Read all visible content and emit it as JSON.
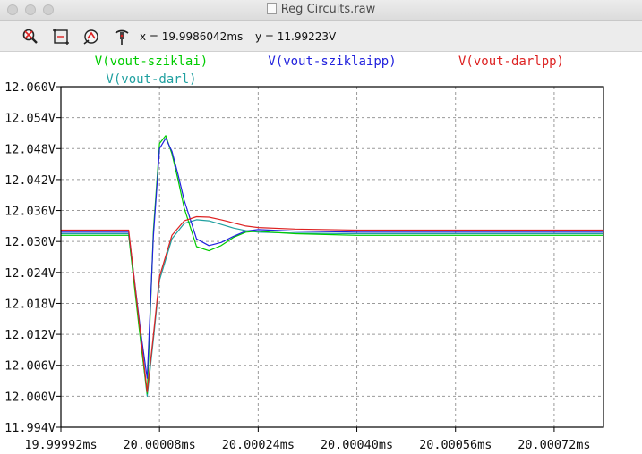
{
  "window": {
    "title": "Reg Circuits.raw"
  },
  "toolbar": {
    "tools": [
      {
        "name": "zoom-area-icon"
      },
      {
        "name": "zoom-full-icon"
      },
      {
        "name": "pan-icon"
      },
      {
        "name": "probe-icon"
      }
    ],
    "x_readout": "x = 19.9986042ms",
    "y_readout": "y = 11.99223V"
  },
  "chart_data": {
    "type": "line",
    "x_unit": "ms",
    "xlim": [
      19.99992,
      20.0008
    ],
    "ylim": [
      11.994,
      12.06
    ],
    "x_ticks": [
      "19.99992ms",
      "20.00008ms",
      "20.00024ms",
      "20.00040ms",
      "20.00056ms",
      "20.00072ms"
    ],
    "x_tick_values": [
      19.99992,
      20.00008,
      20.00024,
      20.0004,
      20.00056,
      20.00072
    ],
    "y_ticks": [
      "11.994V",
      "12.000V",
      "12.006V",
      "12.012V",
      "12.018V",
      "12.024V",
      "12.030V",
      "12.036V",
      "12.042V",
      "12.048V",
      "12.054V",
      "12.060V"
    ],
    "y_tick_values": [
      11.994,
      12.0,
      12.006,
      12.012,
      12.018,
      12.024,
      12.03,
      12.036,
      12.042,
      12.048,
      12.054,
      12.06
    ],
    "grid": true,
    "series": [
      {
        "name": "V(vout-darl)",
        "color": "#20a0a0",
        "x": [
          19.99992,
          20.0,
          20.00003,
          20.00005,
          20.00006,
          20.00007,
          20.00008,
          20.0001,
          20.00012,
          20.00014,
          20.00016,
          20.00018,
          20.0002,
          20.00022,
          20.00024,
          20.0003,
          20.0004,
          20.0005,
          20.0006,
          20.0007,
          20.0008
        ],
        "y": [
          12.0315,
          12.0315,
          12.0315,
          12.0105,
          12.0,
          12.011,
          12.0225,
          12.0305,
          12.0335,
          12.0342,
          12.034,
          12.0333,
          12.0326,
          12.0321,
          12.0318,
          12.0316,
          12.0315,
          12.0315,
          12.0315,
          12.0315,
          12.0315
        ]
      },
      {
        "name": "V(vout-sziklai)",
        "color": "#00cc00",
        "x": [
          19.99992,
          20.0,
          20.00003,
          20.00005,
          20.00006,
          20.00007,
          20.00008,
          20.00009,
          20.0001,
          20.00011,
          20.00012,
          20.00014,
          20.00016,
          20.00018,
          20.0002,
          20.00022,
          20.00024,
          20.00026,
          20.0003,
          20.0004,
          20.0005,
          20.0006,
          20.0007,
          20.0008
        ],
        "y": [
          12.0312,
          12.0312,
          12.0312,
          12.01,
          12.0005,
          12.032,
          12.049,
          12.0505,
          12.047,
          12.042,
          12.0365,
          12.029,
          12.0282,
          12.0292,
          12.0308,
          12.0318,
          12.032,
          12.0318,
          12.0315,
          12.0312,
          12.0312,
          12.0312,
          12.0312,
          12.0312
        ]
      },
      {
        "name": "V(vout-sziklaipp)",
        "color": "#2222dd",
        "x": [
          19.99992,
          20.0,
          20.00003,
          20.00005,
          20.00006,
          20.00007,
          20.00008,
          20.00009,
          20.0001,
          20.00011,
          20.00012,
          20.00014,
          20.00016,
          20.00018,
          20.0002,
          20.00022,
          20.00024,
          20.00026,
          20.0003,
          20.0004,
          20.0005,
          20.0006,
          20.0007,
          20.0008
        ],
        "y": [
          12.0318,
          12.0318,
          12.0318,
          12.012,
          12.0035,
          12.031,
          12.048,
          12.05,
          12.0475,
          12.043,
          12.038,
          12.0305,
          12.0292,
          12.0298,
          12.031,
          12.032,
          12.0323,
          12.0322,
          12.032,
          12.0318,
          12.0318,
          12.0318,
          12.0318,
          12.0318
        ]
      },
      {
        "name": "V(vout-darlpp)",
        "color": "#dd2222",
        "x": [
          19.99992,
          20.0,
          20.00003,
          20.00005,
          20.00006,
          20.00007,
          20.00008,
          20.0001,
          20.00012,
          20.00014,
          20.00016,
          20.00018,
          20.0002,
          20.00022,
          20.00024,
          20.0003,
          20.0004,
          20.0005,
          20.0006,
          20.0007,
          20.0008
        ],
        "y": [
          12.0322,
          12.0322,
          12.0322,
          12.0112,
          12.0008,
          12.0118,
          12.0232,
          12.0312,
          12.034,
          12.0348,
          12.0347,
          12.0342,
          12.0336,
          12.033,
          12.0327,
          12.0324,
          12.0322,
          12.0322,
          12.0322,
          12.0322,
          12.0322
        ]
      }
    ],
    "legend": [
      {
        "label": "V(vout-sziklai)",
        "color": "#00cc00"
      },
      {
        "label": "V(vout-darl)",
        "color": "#20a0a0"
      },
      {
        "label": "V(vout-sziklaipp)",
        "color": "#2222dd"
      },
      {
        "label": "V(vout-darlpp)",
        "color": "#dd2222"
      }
    ]
  }
}
